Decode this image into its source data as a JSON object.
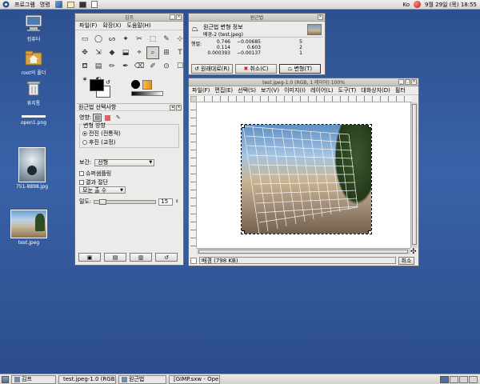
{
  "topbar": {
    "apps_menu": "프로그램",
    "places_menu": "명령",
    "keyboard": "Ko",
    "clock": "9월 29일 (목) 18:55"
  },
  "desktop": {
    "icons": [
      {
        "label": "컴퓨터"
      },
      {
        "label": "root의 폴더"
      },
      {
        "label": "휴지통"
      },
      {
        "label": "open1.png"
      },
      {
        "label": "751-8898.jpg"
      },
      {
        "label": "test.jpeg"
      }
    ]
  },
  "toolbox": {
    "title": "김프",
    "menu": [
      "파일(F)",
      "확장(X)",
      "도움말(H)"
    ],
    "tools": [
      "▭",
      "◯",
      "ᔕ",
      "✦",
      "✂",
      "⬚",
      "✎",
      "⊹",
      "✥",
      "⇲",
      "◆",
      "⬓",
      "⌖",
      "⌕",
      "⊞",
      "T",
      "⛾",
      "▤",
      "✏",
      "✒",
      "⌫",
      "✐",
      "⊙",
      "☐",
      "✶",
      "◐"
    ],
    "tool_options": {
      "title": "원근법 선택사항",
      "affect_label": "영향:",
      "direction_label": "변형 방향",
      "direction_forward": "전진 (전통적)",
      "direction_backward": "후진 (교정)",
      "interpolation_label": "보간:",
      "interpolation_value": "선형",
      "supersampling": "슈퍼샘플링",
      "clip_result": "결과 절단",
      "preview_value": "모눈 출 수",
      "density_label": "밀도:",
      "density_value": "15"
    }
  },
  "perspective": {
    "title": "원근법",
    "header_title": "원근법 변형 정보",
    "header_sub": "배경-2 (test.jpeg)",
    "matrix_label": "행렬:",
    "matrix": [
      [
        "0.746",
        "−0.00685",
        "5"
      ],
      [
        "0.114",
        "0.603",
        "2"
      ],
      [
        "0.000393",
        "−0.00137",
        "1"
      ]
    ],
    "reset_button": "원래대로(R)",
    "cancel_button": "취소(C)",
    "transform_button": "변형(T)"
  },
  "image_window": {
    "title": "test.jpeg-1.0 (RGB, 1 레이어) 100%",
    "menu": [
      "파일(F)",
      "편집(E)",
      "선택(S)",
      "보기(V)",
      "이미지(I)",
      "레이어(L)",
      "도구(T)",
      "대화상자(D)",
      "필터"
    ],
    "status": "배경 (798 KB)",
    "cancel": "취소"
  },
  "taskbar": {
    "items": [
      {
        "label": "김프"
      },
      {
        "label": "test.jpeg-1.0 (RGB"
      },
      {
        "label": "원근법"
      },
      {
        "label": "[GIMP.sxw - Open"
      }
    ]
  },
  "colors": {
    "desktop_top": "#2c4f8e",
    "desktop_bottom": "#2b4c8a",
    "window_bg": "#ecebe9"
  }
}
